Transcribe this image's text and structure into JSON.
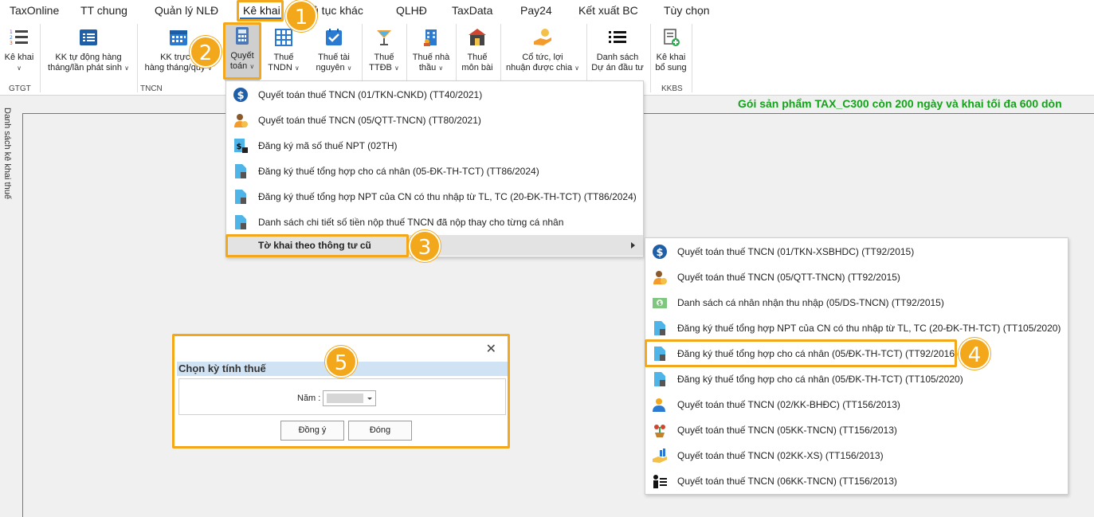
{
  "menubar": {
    "tabs": [
      "TaxOnline",
      "TT chung",
      "Quản lý NLĐ",
      "Kê khai",
      "ủ tục khác",
      "QLHĐ",
      "TaxData",
      "Pay24",
      "Kết xuất BC",
      "Tùy chọn"
    ],
    "active": "Kê khai"
  },
  "ribbon": {
    "buttons": [
      {
        "line1": "Kê khai",
        "line2": ""
      },
      {
        "line1": "KK tự động hàng",
        "line2": "tháng/lần phát sinh"
      },
      {
        "line1": "KK trực ti",
        "line2": "hàng tháng/quý"
      },
      {
        "line1": "Quyết",
        "line2": "toán"
      },
      {
        "line1": "Thuế",
        "line2": "TNDN"
      },
      {
        "line1": "Thuế tài",
        "line2": "nguyên"
      },
      {
        "line1": "Thuế",
        "line2": "TTĐB"
      },
      {
        "line1": "Thuế nhà",
        "line2": "thầu"
      },
      {
        "line1": "Thuế",
        "line2": "môn bài"
      },
      {
        "line1": "Cổ tức, lợi",
        "line2": "nhuận được chia"
      },
      {
        "line1": "Danh sách",
        "line2": "Dự án đầu tư"
      },
      {
        "line1": "Kê khai",
        "line2": "bổ sung"
      }
    ],
    "groups": [
      "GTGT",
      "TNCN",
      "KKBS"
    ]
  },
  "left_panel": {
    "label": "Danh sách kê khai thuế"
  },
  "promo": "Gói sản phẩm TAX_C300 còn 200 ngày và khai tối đa 600 dòn",
  "menu_main": {
    "items": [
      {
        "label": "Quyết toán thuế TNCN (01/TKN-CNKD) (TT40/2021)",
        "icon": "dollar-circle-icon"
      },
      {
        "label": "Quyết toán thuế TNCN (05/QTT-TNCN) (TT80/2021)",
        "icon": "person-coin-icon"
      },
      {
        "label": "Đăng ký mã số thuế NPT (02TH)",
        "icon": "doc-dollar-icon"
      },
      {
        "label": "Đăng ký thuế tổng hợp cho cá nhân (05-ĐK-TH-TCT) (TT86/2024)",
        "icon": "document-icon"
      },
      {
        "label": "Đăng ký thuế tổng hợp NPT của CN có thu nhập từ TL, TC (20-ĐK-TH-TCT) (TT86/2024)",
        "icon": "document-icon"
      },
      {
        "label": "Danh sách chi tiết số tiền nộp thuế TNCN đã nộp thay cho từng cá nhân",
        "icon": "document-icon"
      }
    ],
    "submenu_label": "Tờ khai theo thông tư cũ"
  },
  "menu_sub": {
    "items": [
      {
        "label": "Quyết toán thuế TNCN (01/TKN-XSBHDC) (TT92/2015)",
        "icon": "dollar-circle-icon"
      },
      {
        "label": "Quyết toán thuế TNCN (05/QTT-TNCN) (TT92/2015)",
        "icon": "person-coin-icon"
      },
      {
        "label": "Danh sách cá nhân nhận thu nhập (05/DS-TNCN) (TT92/2015)",
        "icon": "cash-icon"
      },
      {
        "label": "Đăng ký thuế tổng hợp NPT của CN có thu nhập từ TL, TC (20-ĐK-TH-TCT) (TT105/2020)",
        "icon": "document-icon"
      },
      {
        "label": "Đăng ký thuế tổng hợp cho cá nhân (05/ĐK-TH-TCT) (TT92/2016)",
        "icon": "document-icon"
      },
      {
        "label": "Đăng ký thuế tổng hợp cho cá nhân (05/ĐK-TH-TCT) (TT105/2020)",
        "icon": "document-icon"
      },
      {
        "label": "Quyết toán thuế TNCN (02/KK-BHĐC) (TT156/2013)",
        "icon": "person-pen-icon"
      },
      {
        "label": "Quyết toán thuế TNCN (05KK-TNCN) (TT156/2013)",
        "icon": "plant-icon"
      },
      {
        "label": "Quyết toán thuế TNCN (02KK-XS) (TT156/2013)",
        "icon": "hand-chart-icon"
      },
      {
        "label": "Quyết toán thuế TNCN (06KK-TNCN) (TT156/2013)",
        "icon": "person-list-icon"
      }
    ]
  },
  "dialog": {
    "title": "Chọn kỳ tính thuế",
    "year_label": "Năm :",
    "ok_label": "Đồng ý",
    "close_label": "Đóng"
  },
  "callouts": [
    "1",
    "2",
    "3",
    "4",
    "5"
  ],
  "colors": {
    "accent": "#f3a81b",
    "promo": "#13a319",
    "tab_underline": "#2b6cc4",
    "dialog_title_bg": "#cfe3f5"
  }
}
